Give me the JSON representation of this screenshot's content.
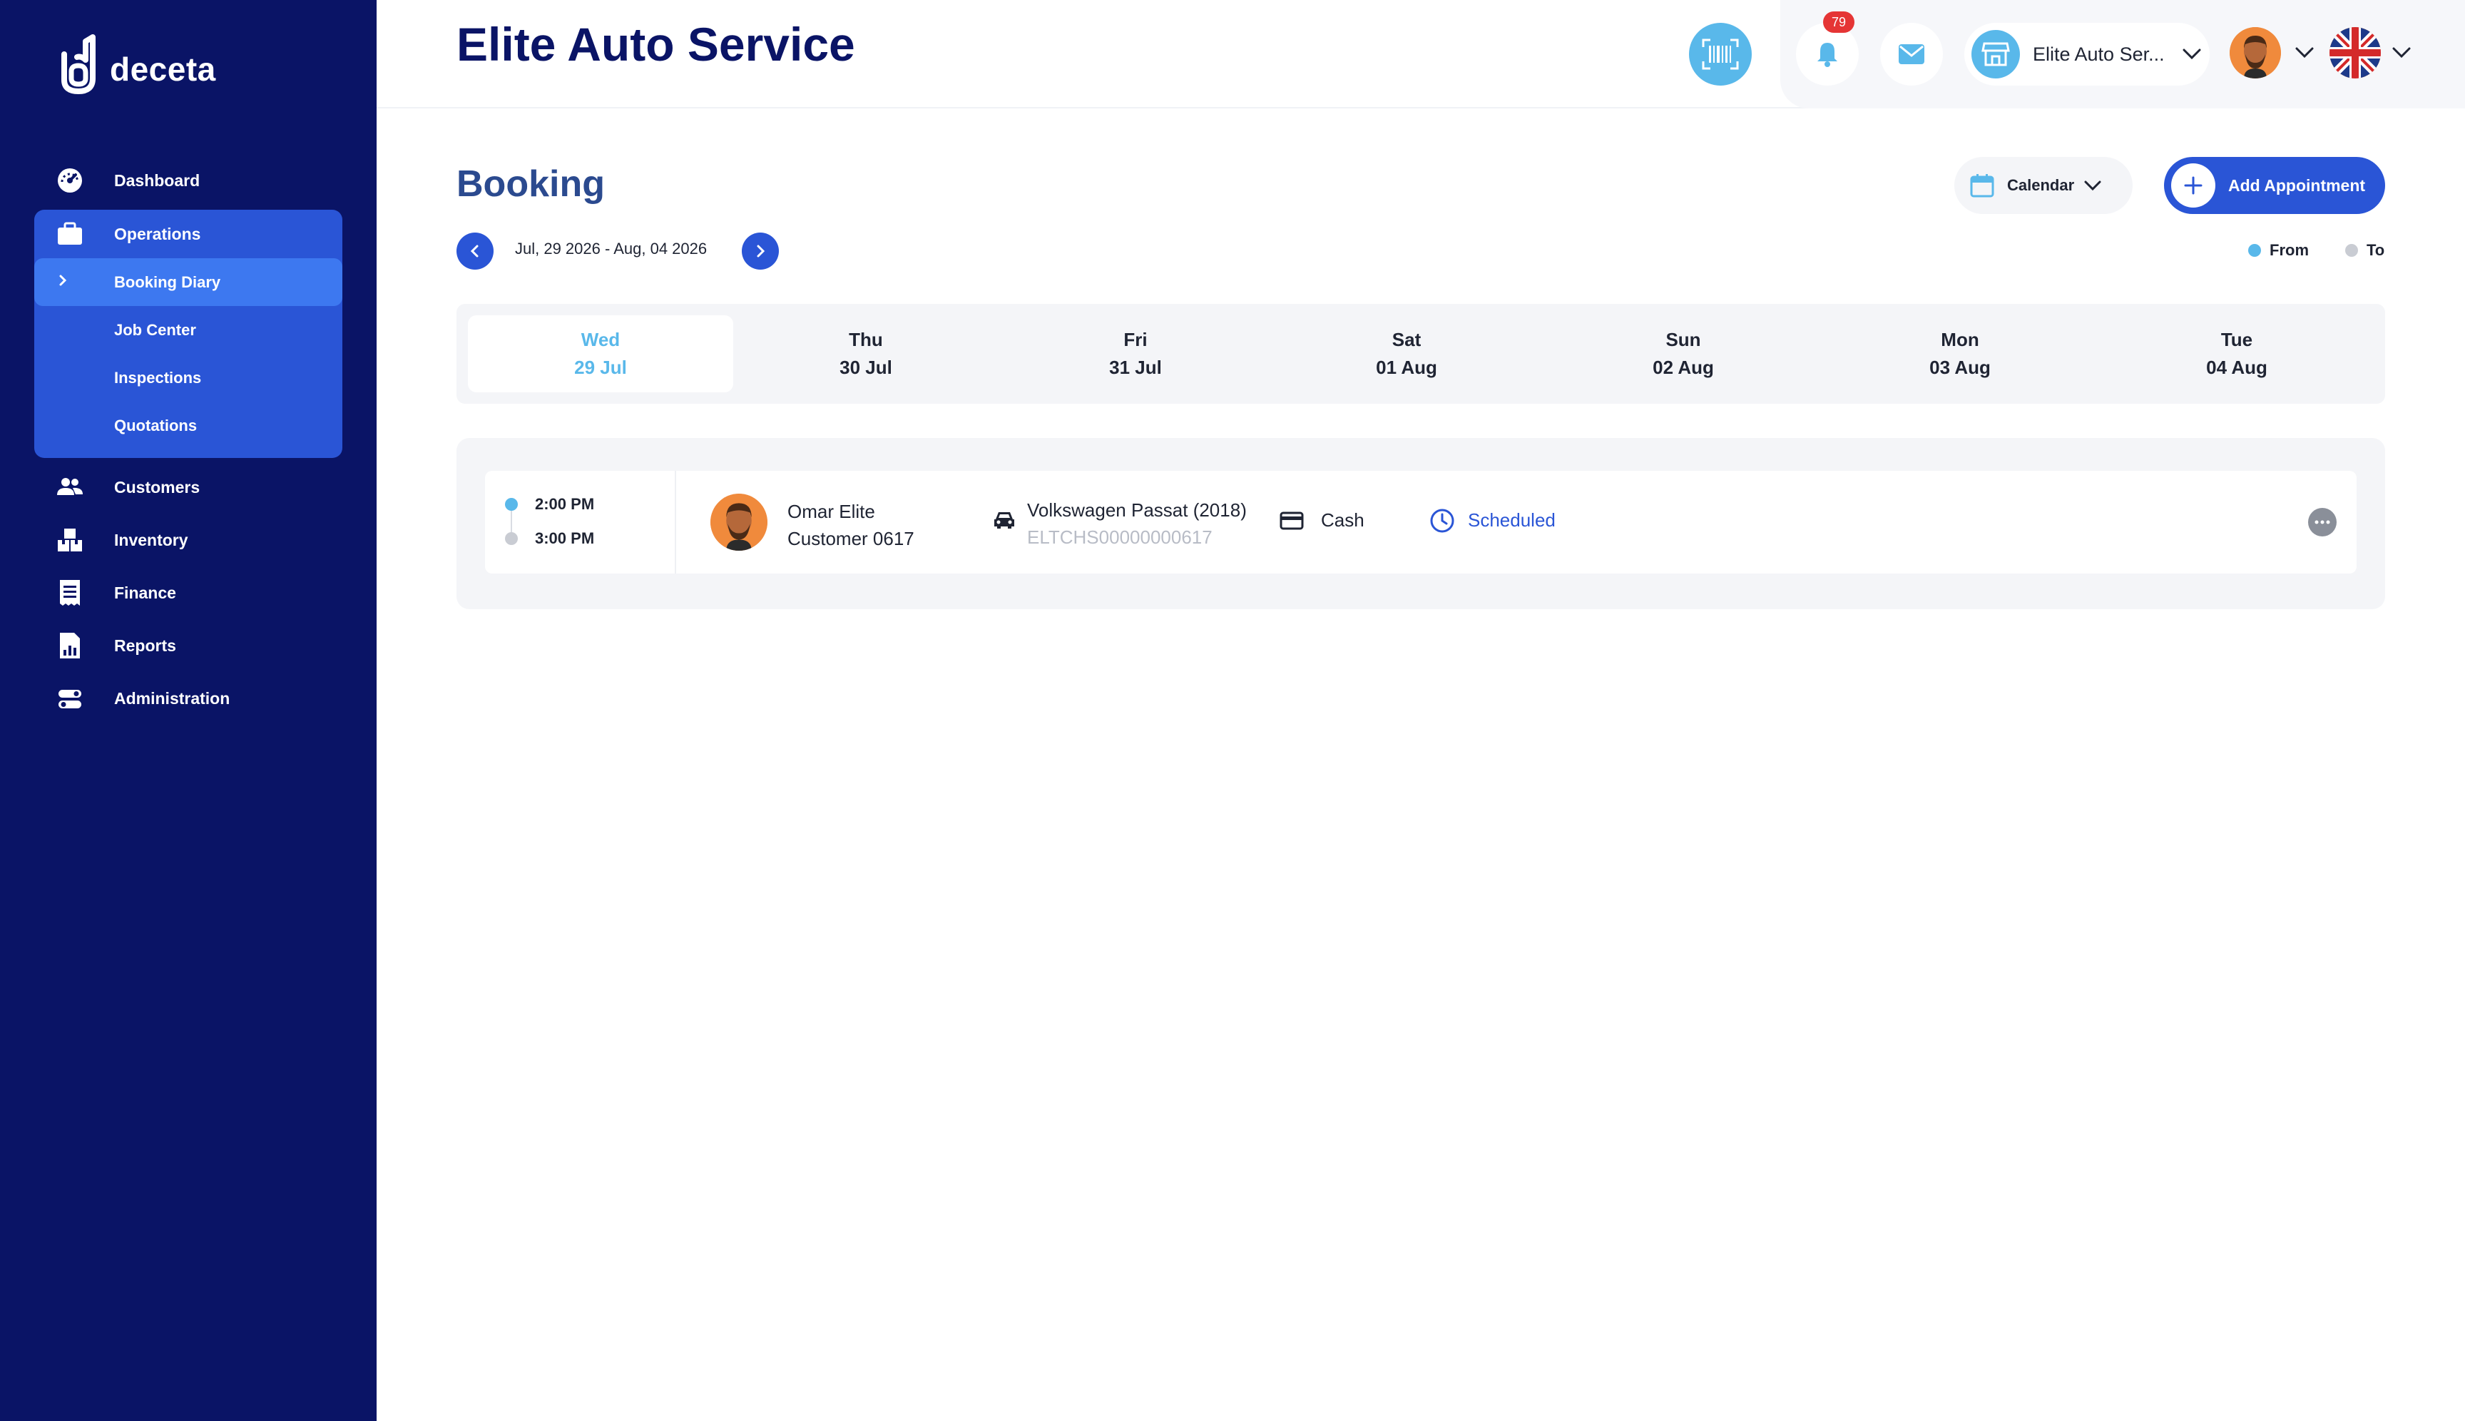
{
  "brand": {
    "name": "deceta"
  },
  "header": {
    "title": "Elite Auto Service",
    "notifications_count": "79",
    "store_name": "Elite Auto Ser...",
    "language": "English (UK)"
  },
  "sidebar": {
    "items": [
      {
        "label": "Dashboard",
        "icon": "dashboard-icon"
      },
      {
        "label": "Operations",
        "icon": "briefcase-icon"
      },
      {
        "label": "Customers",
        "icon": "users-icon"
      },
      {
        "label": "Inventory",
        "icon": "boxes-icon"
      },
      {
        "label": "Finance",
        "icon": "receipt-icon"
      },
      {
        "label": "Reports",
        "icon": "report-icon"
      },
      {
        "label": "Administration",
        "icon": "toggle-icon"
      }
    ],
    "operations_sub": [
      {
        "label": "Booking Diary"
      },
      {
        "label": "Job Center"
      },
      {
        "label": "Inspections"
      },
      {
        "label": "Quotations"
      }
    ]
  },
  "page": {
    "title": "Booking",
    "calendar_label": "Calendar",
    "add_label": "Add Appointment",
    "range": "Jul, 29 2026 -  Aug, 04 2026",
    "legend_from": "From",
    "legend_to": "To"
  },
  "days": [
    {
      "dow": "Wed",
      "date": "29 Jul"
    },
    {
      "dow": "Thu",
      "date": "30 Jul"
    },
    {
      "dow": "Fri",
      "date": "31 Jul"
    },
    {
      "dow": "Sat",
      "date": "01 Aug"
    },
    {
      "dow": "Sun",
      "date": "02 Aug"
    },
    {
      "dow": "Mon",
      "date": "03 Aug"
    },
    {
      "dow": "Tue",
      "date": "04 Aug"
    }
  ],
  "appointment": {
    "time_from": "2:00 PM",
    "time_to": "3:00 PM",
    "customer_name": "Omar Elite",
    "customer_id": "Customer 0617",
    "vehicle": "Volkswagen Passat (2018)",
    "plate": "ELTCHS00000000617",
    "payment": "Cash",
    "status": "Scheduled"
  },
  "colors": {
    "sidebar_bg": "#0a1466",
    "accent": "#2a55d6",
    "accent_light": "#3d78f0",
    "sky": "#59b8ea",
    "badge_red": "#e53535"
  }
}
